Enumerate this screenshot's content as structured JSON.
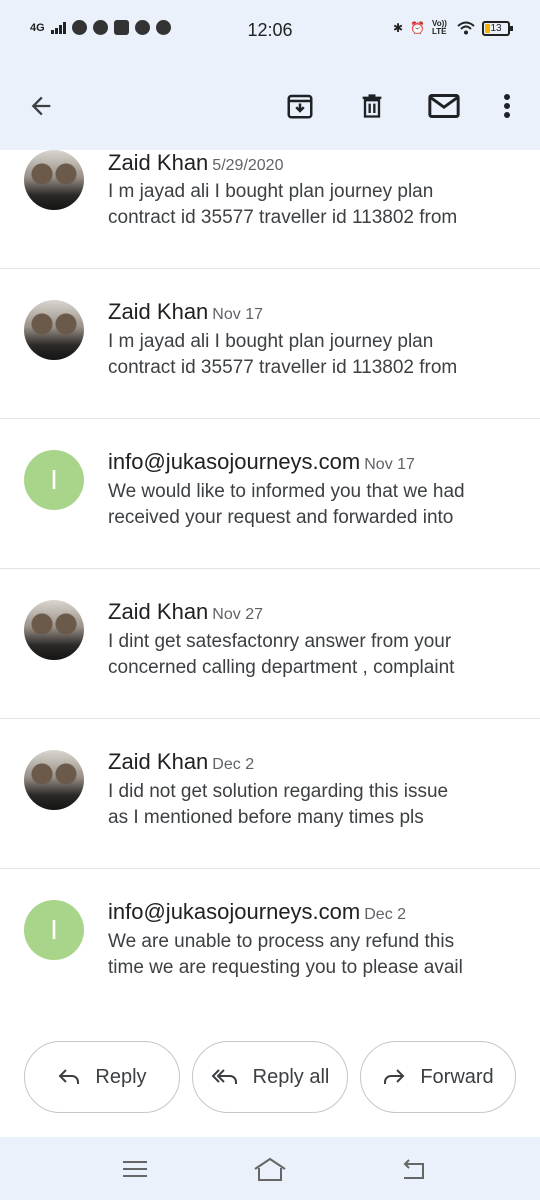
{
  "status_bar": {
    "network": "4G",
    "time": "12:06",
    "volte": "Vo)) LTE",
    "battery": "13"
  },
  "app_bar": {
    "icons": [
      "back-arrow-icon",
      "archive-icon",
      "delete-icon",
      "mark-unread-icon",
      "more-vert-icon"
    ]
  },
  "thread": {
    "messages": [
      {
        "sender": "Zaid Khan",
        "date": "5/29/2020",
        "line1": "I m jayad ali I bought plan journey plan",
        "line2": "contract id 35577 traveller id 113802 from",
        "avatar": "photo"
      },
      {
        "sender": "Zaid Khan",
        "date": "Nov 17",
        "line1": "I m jayad ali I bought plan journey plan",
        "line2": "contract id 35577 traveller id 113802 from",
        "avatar": "photo"
      },
      {
        "sender": "info@jukasojourneys.com",
        "date": "Nov 17",
        "line1": "We would like to informed you that we had",
        "line2": "received your request and forwarded into",
        "avatar": "I"
      },
      {
        "sender": "Zaid Khan",
        "date": "Nov 27",
        "line1": "I dint get satesfactonry answer from your",
        "line2": "concerned calling department , complaint",
        "avatar": "photo"
      },
      {
        "sender": "Zaid Khan",
        "date": "Dec 2",
        "line1": "I did not get solution regarding this issue",
        "line2": "as I mentioned before many times pls",
        "avatar": "photo"
      },
      {
        "sender": "info@jukasojourneys.com",
        "date": "Dec 2",
        "line1": "We are unable to process any refund this",
        "line2": "time we are requesting you to please avail",
        "avatar": "I"
      }
    ]
  },
  "actions": {
    "reply": "Reply",
    "reply_all": "Reply all",
    "forward": "Forward"
  },
  "colors": {
    "bar_bg": "#eaf1fb",
    "letter_avatar": "#a8d58a",
    "text_primary": "#202124",
    "text_secondary": "#5f6368"
  }
}
